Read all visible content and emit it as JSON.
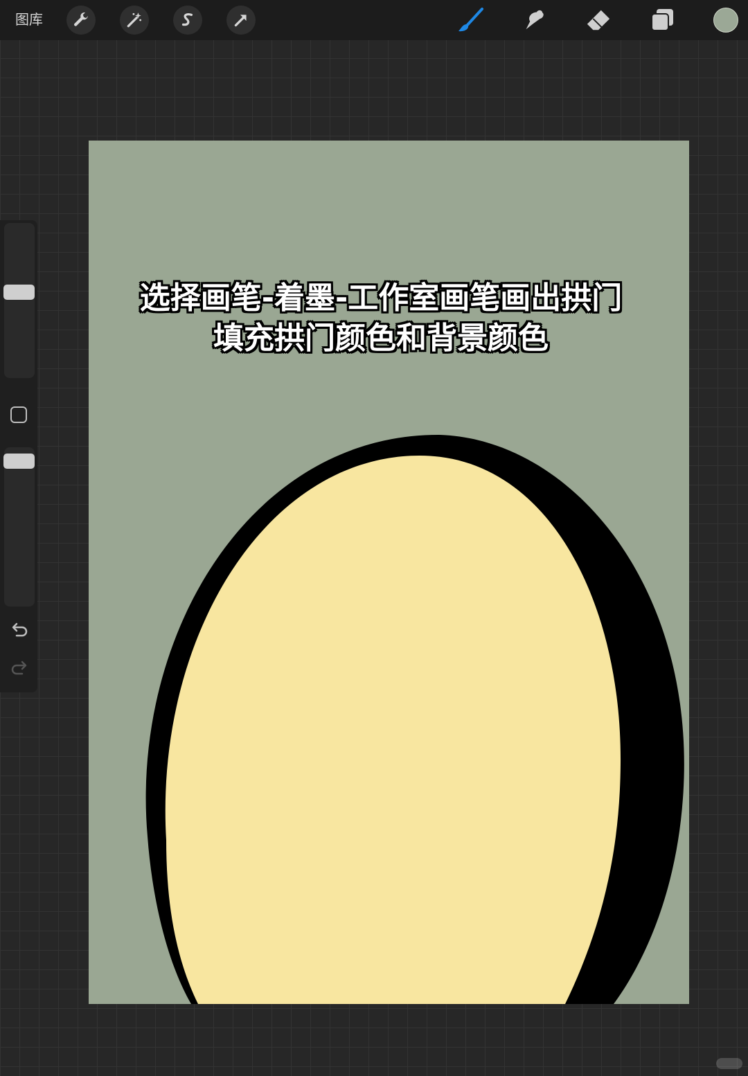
{
  "topbar": {
    "gallery_label": "图库",
    "left_tools": [
      "wrench-icon",
      "magic-wand-icon",
      "selection-s-icon",
      "transform-arrow-icon"
    ],
    "right_tools": [
      "brush-icon",
      "smudge-icon",
      "eraser-icon",
      "layers-icon"
    ],
    "current_color": "#9ba896"
  },
  "sidebar": {
    "icons": [
      "modify-square-icon",
      "undo-icon",
      "redo-icon"
    ]
  },
  "canvas": {
    "background_color": "#9aa793",
    "arch_fill_color": "#f8e6a0",
    "arch_outline_color": "#000000"
  },
  "caption": {
    "line1": "选择画笔-着墨-工作室画笔画出拱门",
    "line2": "填充拱门颜色和背景颜色"
  },
  "colors": {
    "accent_blue": "#1e88e5",
    "ui_dark": "#1c1c1c"
  }
}
